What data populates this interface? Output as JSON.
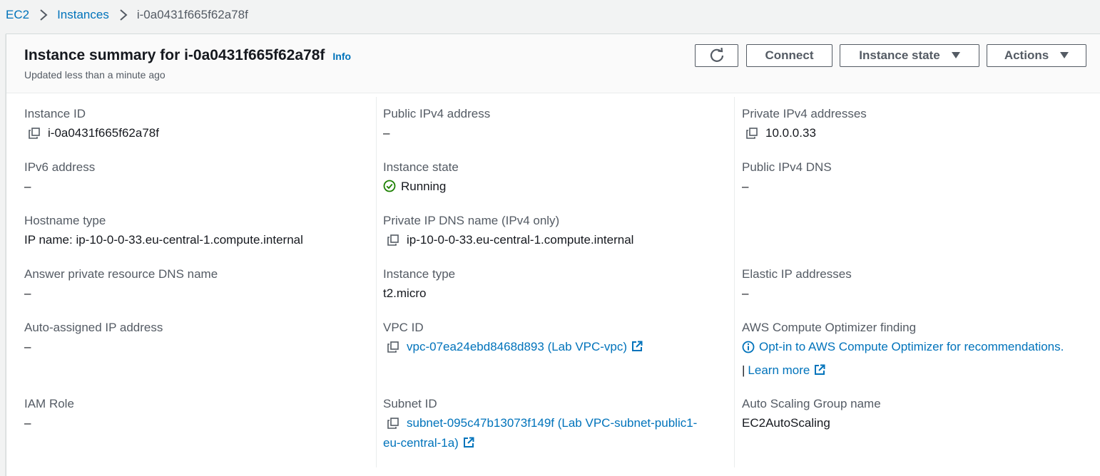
{
  "breadcrumb": {
    "root": "EC2",
    "section": "Instances",
    "current": "i-0a0431f665f62a78f"
  },
  "header": {
    "title": "Instance summary for i-0a0431f665f62a78f",
    "info": "Info",
    "updated": "Updated less than a minute ago",
    "buttons": {
      "connect": "Connect",
      "instance_state": "Instance state",
      "actions": "Actions"
    }
  },
  "details": {
    "instance_id": {
      "label": "Instance ID",
      "value": "i-0a0431f665f62a78f"
    },
    "ipv6": {
      "label": "IPv6 address",
      "value": "–"
    },
    "hostname_type": {
      "label": "Hostname type",
      "value": "IP name: ip-10-0-0-33.eu-central-1.compute.internal"
    },
    "answer_dns": {
      "label": "Answer private resource DNS name",
      "value": "–"
    },
    "auto_ip": {
      "label": "Auto-assigned IP address",
      "value": "–"
    },
    "iam_role": {
      "label": "IAM Role",
      "value": "–"
    },
    "public_ipv4": {
      "label": "Public IPv4 address",
      "value": "–"
    },
    "instance_state": {
      "label": "Instance state",
      "value": "Running"
    },
    "private_dns": {
      "label": "Private IP DNS name (IPv4 only)",
      "value": "ip-10-0-0-33.eu-central-1.compute.internal"
    },
    "instance_type": {
      "label": "Instance type",
      "value": "t2.micro"
    },
    "vpc_id": {
      "label": "VPC ID",
      "value": "vpc-07ea24ebd8468d893 (Lab VPC-vpc)"
    },
    "subnet_id": {
      "label": "Subnet ID",
      "value_line1": "subnet-095c47b13073f149f (Lab VPC-subnet-public1-",
      "value_line2": "eu-central-1a)"
    },
    "private_ipv4": {
      "label": "Private IPv4 addresses",
      "value": "10.0.0.33"
    },
    "public_dns": {
      "label": "Public IPv4 DNS",
      "value": "–"
    },
    "elastic_ip": {
      "label": "Elastic IP addresses",
      "value": "–"
    },
    "optimizer": {
      "label": "AWS Compute Optimizer finding",
      "value": "Opt-in to AWS Compute Optimizer for recommendations.",
      "learn_more": "Learn more",
      "pipe": "|"
    },
    "asg": {
      "label": "Auto Scaling Group name",
      "value": "EC2AutoScaling"
    }
  },
  "colors": {
    "link": "#0073bb",
    "running": "#1d8102",
    "label": "#545b64",
    "text": "#16191f"
  },
  "icons": [
    "chevron-right-icon",
    "refresh-icon",
    "caret-down-icon",
    "copy-icon",
    "check-circle-icon",
    "external-link-icon",
    "info-circle-icon"
  ]
}
